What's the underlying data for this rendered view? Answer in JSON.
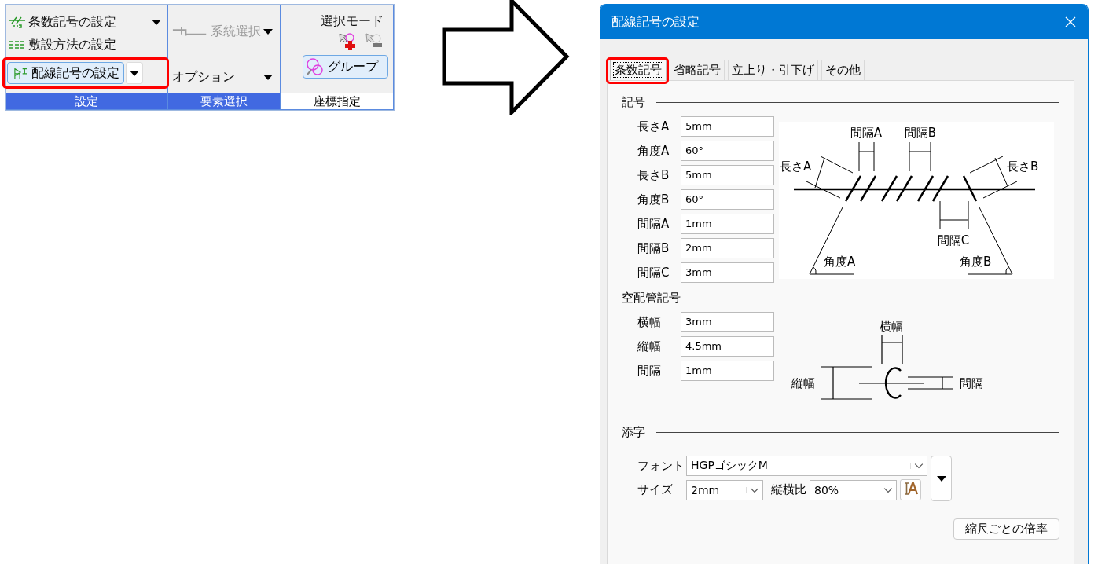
{
  "ribbon": {
    "settings_group": {
      "label": "設定",
      "highlighted": true,
      "items": [
        {
          "label": "条数記号の設定",
          "kind": "dropdown"
        },
        {
          "label": "敷設方法の設定",
          "kind": "command"
        },
        {
          "label": "配線記号の設定",
          "kind": "split_button",
          "callout": true
        }
      ]
    },
    "element_group": {
      "label": "要素選択",
      "highlighted": true,
      "items": [
        {
          "label": "系統選択",
          "kind": "dropdown",
          "disabled": true
        },
        {
          "label": "オプション",
          "kind": "dropdown",
          "disabled": false
        }
      ]
    },
    "coordinate_group": {
      "label": "座標指定",
      "highlighted": false,
      "mode_label": "選択モード",
      "group_button": "グループ"
    }
  },
  "dialog": {
    "title": "配線記号の設定",
    "tabs": [
      {
        "label": "条数記号",
        "selected": true,
        "callout": true
      },
      {
        "label": "省略記号",
        "selected": false,
        "callout": false
      },
      {
        "label": "立上り・引下げ",
        "selected": false,
        "callout": false
      },
      {
        "label": "その他",
        "selected": false,
        "callout": false
      }
    ],
    "symbol_section": {
      "title": "記号",
      "fields": [
        {
          "label": "長さA",
          "value": "5mm"
        },
        {
          "label": "角度A",
          "value": "60°"
        },
        {
          "label": "長さB",
          "value": "5mm"
        },
        {
          "label": "角度B",
          "value": "60°"
        },
        {
          "label": "間隔A",
          "value": "1mm"
        },
        {
          "label": "間隔B",
          "value": "2mm"
        },
        {
          "label": "間隔C",
          "value": "3mm"
        }
      ],
      "diagram_labels": [
        "間隔A",
        "間隔B",
        "長さA",
        "長さB",
        "間隔C",
        "角度A",
        "角度B"
      ]
    },
    "empty_conduit_section": {
      "title": "空配管記号",
      "fields": [
        {
          "label": "横幅",
          "value": "3mm"
        },
        {
          "label": "縦幅",
          "value": "4.5mm"
        },
        {
          "label": "間隔",
          "value": "1mm"
        }
      ],
      "diagram_labels": [
        "横幅",
        "縦幅",
        "間隔"
      ]
    },
    "subscript_section": {
      "title": "添字",
      "font": {
        "label": "フォント",
        "value": "HGPゴシックM"
      },
      "size": {
        "label": "サイズ",
        "value": "2mm"
      },
      "aspect_ratio": {
        "label": "縦横比",
        "value": "80%"
      }
    },
    "scale_button": "縮尺ごとの倍率"
  }
}
